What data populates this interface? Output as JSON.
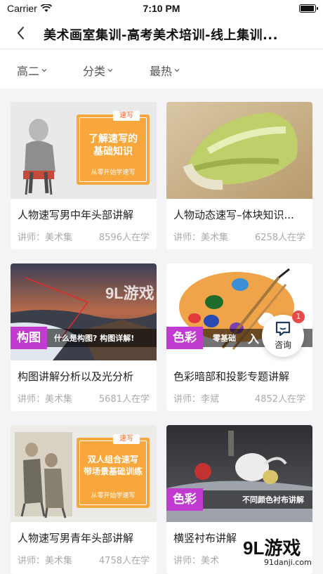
{
  "status_bar": {
    "carrier": "Carrier",
    "time": "7:10 PM",
    "battery_level": 1.0
  },
  "nav": {
    "title": "美术画室集训-高考美术培训-线上集训...",
    "back_icon": "chevron-left-icon"
  },
  "filters": [
    {
      "label": "高二"
    },
    {
      "label": "分类"
    },
    {
      "label": "最热"
    }
  ],
  "courses": [
    {
      "title": "人物速写男中年头部讲解",
      "teacher": "讲师：美术集",
      "learners": "8596人在学",
      "thumb": {
        "tag": "速写",
        "heading_l1": "了解速写的",
        "heading_l2": "基础知识",
        "sub": "从零开始学速写"
      }
    },
    {
      "title": "人物动态速写–体块知识...",
      "teacher": "讲师：美术集",
      "learners": "6258人在学",
      "thumb": {}
    },
    {
      "title": "构图讲解分析以及光分析",
      "teacher": "讲师：美术集",
      "learners": "5681人在学",
      "thumb": {
        "badge": "构图",
        "caption": "什么是构图? 构图详解!"
      }
    },
    {
      "title": "色彩暗部和投影专题讲解",
      "teacher": "讲师：李斌",
      "learners": "4852人在学",
      "thumb": {
        "badge": "色彩",
        "caption": "零基础",
        "caption_extra": "入"
      }
    },
    {
      "title": "人物速写男青年头部讲解",
      "teacher": "讲师：美术集",
      "learners": "4758人在学",
      "thumb": {
        "tag": "速写",
        "heading_l1": "双人组合速写",
        "heading_l2": "带场景基础训练",
        "sub": "从零开始学速写"
      }
    },
    {
      "title": "横竖衬布讲解",
      "teacher": "讲师：美术",
      "learners": "",
      "thumb": {
        "badge": "色彩",
        "caption": "不同颜色衬布讲解"
      }
    }
  ],
  "consult": {
    "label": "咨询",
    "badge_count": "1"
  },
  "watermark": {
    "brand": "9L游戏",
    "url": "91danji.com"
  },
  "colors": {
    "accent_purple": "#c23bd0",
    "tag_orange": "#f5a43a",
    "badge_red": "#e84a4a"
  }
}
